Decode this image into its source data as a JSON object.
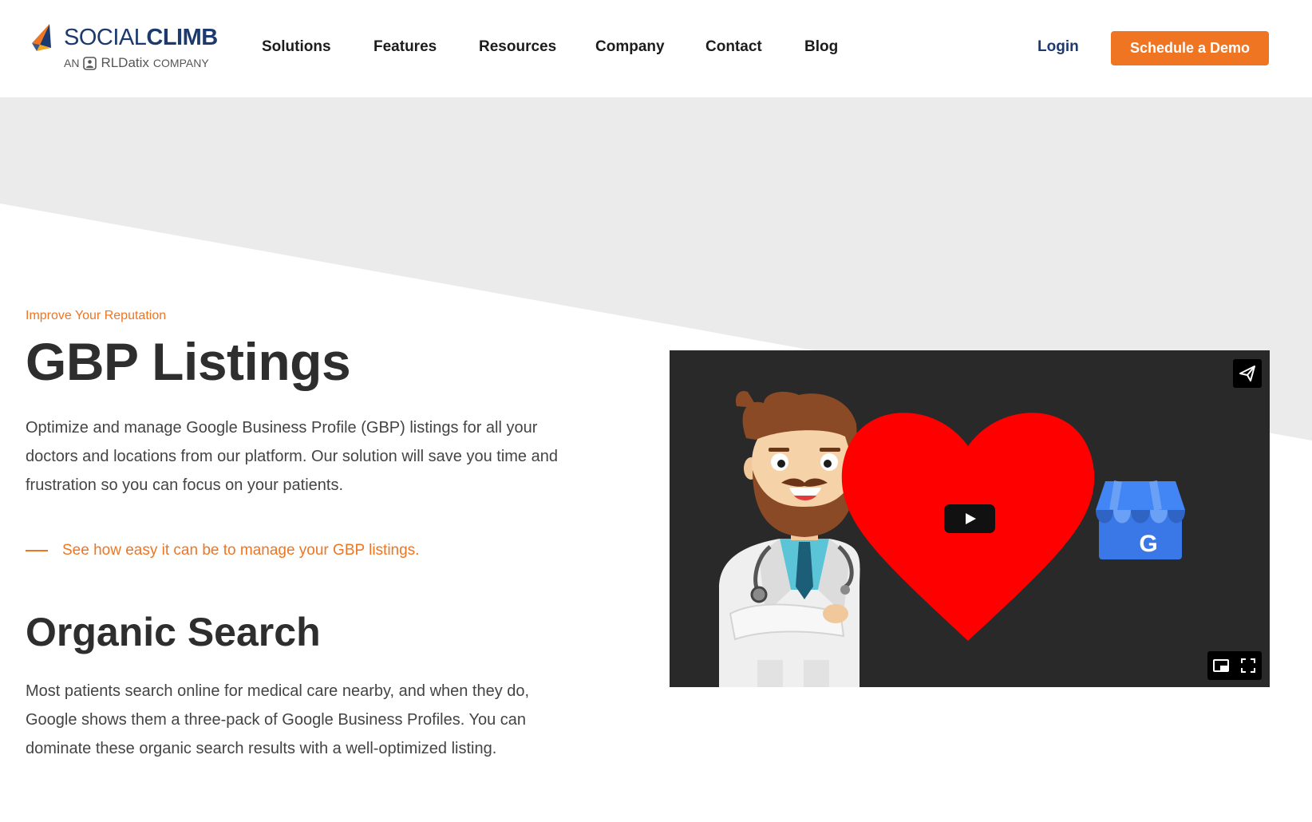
{
  "brand": {
    "name_light": "SOCIAL",
    "name_bold": "CLIMB",
    "tagline_prefix": "AN",
    "tagline_company": "RLDatix",
    "tagline_suffix": "COMPANY",
    "logo_icon": "socialclimb-flag-icon",
    "colors": {
      "navy": "#1d3a6e",
      "orange": "#ef7522",
      "gold": "#f2a922"
    }
  },
  "nav": {
    "items": [
      {
        "label": "Solutions"
      },
      {
        "label": "Features"
      },
      {
        "label": "Resources"
      },
      {
        "label": "Company"
      },
      {
        "label": "Contact"
      },
      {
        "label": "Blog"
      }
    ],
    "login_label": "Login",
    "cta_label": "Schedule a Demo"
  },
  "hero": {
    "eyebrow": "Improve Your Reputation",
    "title": "GBP Listings",
    "description": "Optimize and manage Google Business Profile (GBP) listings for all your doctors and locations from our platform. Our solution will save you time and frustration so you can focus on your patients.",
    "link_text": "See how easy it can be to manage your GBP listings."
  },
  "section2": {
    "title": "Organic Search",
    "description": "Most patients search online for medical care nearby, and when they do, Google shows them a three-pack of Google Business Profiles. You can dominate these organic search results with a well-optimized listing."
  },
  "video": {
    "thumbnail_icons": [
      "doctor-illustration",
      "heart-icon",
      "google-business-store-icon"
    ],
    "store_badge_letter": "G",
    "controls": [
      "play-icon",
      "share-icon",
      "picture-in-picture-icon",
      "fullscreen-icon"
    ],
    "colors": {
      "background": "#2a2929",
      "heart": "#ff0000",
      "store_blue": "#3b78e7"
    }
  }
}
